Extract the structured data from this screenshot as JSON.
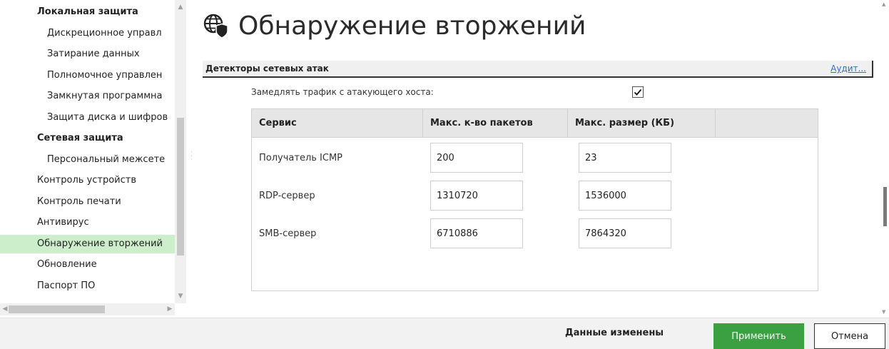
{
  "sidebar": {
    "items": [
      {
        "label": "Локальная защита",
        "bold": true
      },
      {
        "label": "Дискреционное управл"
      },
      {
        "label": "Затирание данных"
      },
      {
        "label": "Полномочное управлен"
      },
      {
        "label": "Замкнутая программна"
      },
      {
        "label": "Защита диска и шифров"
      },
      {
        "label": "Сетевая защита",
        "bold": true
      },
      {
        "label": "Персональный межсете"
      },
      {
        "label": "Контроль устройств"
      },
      {
        "label": "Контроль печати"
      },
      {
        "label": "Антивирус"
      },
      {
        "label": "Обнаружение вторжений",
        "active": true
      },
      {
        "label": "Обновление"
      },
      {
        "label": "Паспорт ПО"
      }
    ]
  },
  "page": {
    "title": "Обнаружение вторжений",
    "icon": "globe-shield-icon"
  },
  "section": {
    "title": "Детекторы сетевых атак",
    "audit_link": "Аудит..."
  },
  "slow_traffic": {
    "label": "Замедлять трафик с атакующего хоста:",
    "checked": true
  },
  "table": {
    "headers": [
      "Сервис",
      "Макс. к-во пакетов",
      "Макс. размер (КБ)",
      ""
    ],
    "rows": [
      {
        "service": "Получатель ICMP",
        "max_packets": "200",
        "max_size": "23"
      },
      {
        "service": "RDP-сервер",
        "max_packets": "1310720",
        "max_size": "1536000"
      },
      {
        "service": "SMB-сервер",
        "max_packets": "6710886",
        "max_size": "7864320"
      }
    ]
  },
  "footer": {
    "status": "Данные изменены",
    "apply_label": "Применить",
    "cancel_label": "Отмена"
  },
  "colors": {
    "active_nav": "#cdeeca",
    "apply_button": "#3aa041",
    "link": "#2a6fd6"
  }
}
